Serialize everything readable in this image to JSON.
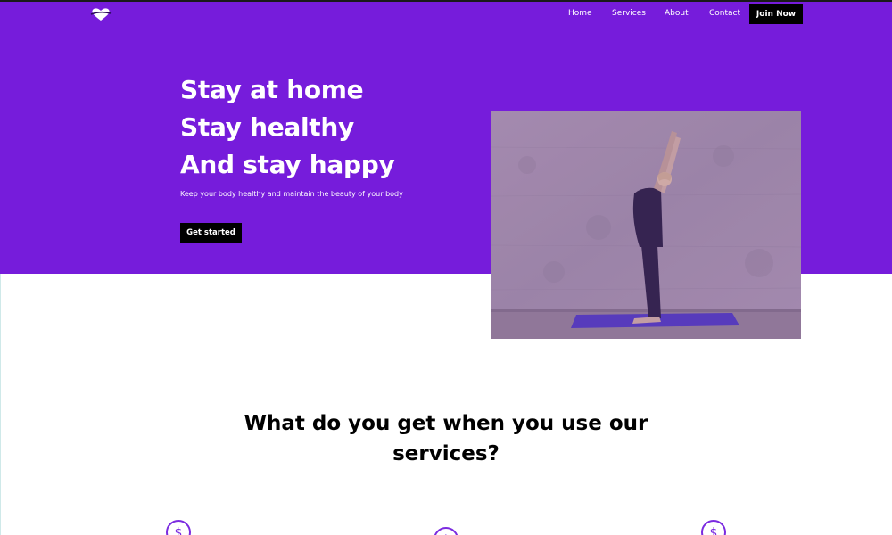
{
  "nav": {
    "links": [
      "Home",
      "Services",
      "About",
      "Contact"
    ],
    "join_label": "Join Now"
  },
  "hero": {
    "lines": [
      "Stay at home",
      "Stay healthy",
      "And stay happy"
    ],
    "subtitle": "Keep your body healthy and maintain the beauty of your body",
    "cta_label": "Get started"
  },
  "services": {
    "title": "What do you get when you use our services?"
  },
  "icons": {
    "logo": "heart-logo-icon",
    "feature": "dollar-circle-icon"
  },
  "colors": {
    "brand": "#761cdb",
    "button": "#000000",
    "accent": "#7b2be0"
  }
}
